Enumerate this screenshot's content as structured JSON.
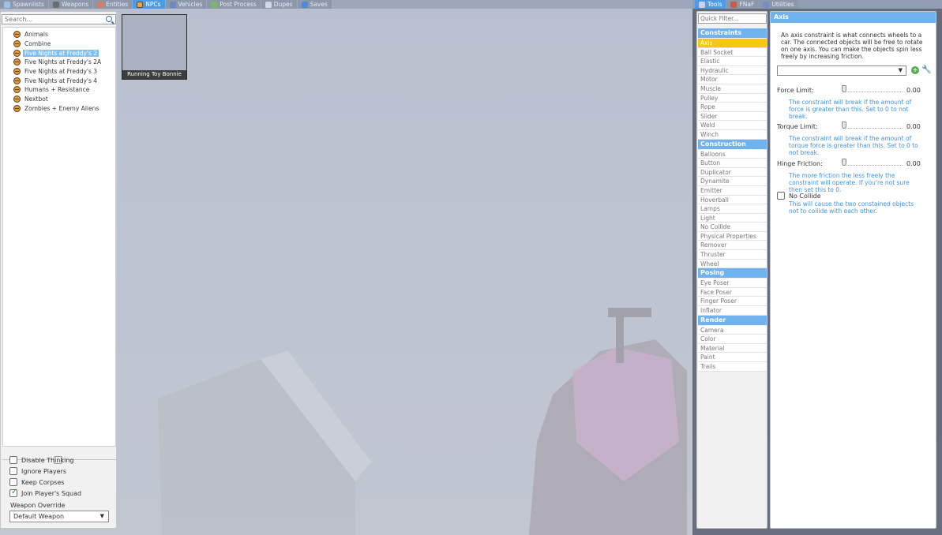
{
  "spawnmenu": {
    "tabs": [
      {
        "label": "Spawnlists",
        "icon": "grid-icon"
      },
      {
        "label": "Weapons",
        "icon": "gun-icon"
      },
      {
        "label": "Entities",
        "icon": "entity-icon"
      },
      {
        "label": "NPCs",
        "icon": "npc-face-icon"
      },
      {
        "label": "Vehicles",
        "icon": "car-icon"
      },
      {
        "label": "Post Process",
        "icon": "film-icon"
      },
      {
        "label": "Dupes",
        "icon": "dupe-icon"
      },
      {
        "label": "Saves",
        "icon": "save-icon"
      }
    ],
    "search_placeholder": "Search...",
    "npc_categories": [
      "Animals",
      "Combine",
      "Five Nights at Freddy's 2",
      "Five Nights at Freddy's 2A",
      "Five Nights at Freddy's 3",
      "Five Nights at Freddy's 4",
      "Humans + Resistance",
      "Nextbot",
      "Zombies + Enemy Aliens"
    ],
    "selected_category": "Five Nights at Freddy's 2",
    "options": {
      "disable_thinking": {
        "label": "Disable Thinking",
        "checked": false
      },
      "ignore_players": {
        "label": "Ignore Players",
        "checked": false
      },
      "keep_corpses": {
        "label": "Keep Corpses",
        "checked": false
      },
      "join_squad": {
        "label": "Join Player's Squad",
        "checked": true
      }
    },
    "weapon_override_label": "Weapon Override",
    "weapon_override_value": "Default Weapon",
    "spawn_icons": [
      {
        "caption": "Running Toy Bonnie"
      }
    ]
  },
  "context": {
    "tabs": [
      {
        "label": "Tools",
        "icon": "wrench-icon"
      },
      {
        "label": "FNaF",
        "icon": "fnaf-icon"
      },
      {
        "label": "Utilities",
        "icon": "utilities-icon"
      }
    ],
    "quick_filter_placeholder": "Quick Filter...",
    "categories": [
      {
        "name": "Constraints",
        "tools": [
          "Axis",
          "Ball Socket",
          "Elastic",
          "Hydraulic",
          "Motor",
          "Muscle",
          "Pulley",
          "Rope",
          "Slider",
          "Weld",
          "Winch"
        ]
      },
      {
        "name": "Construction",
        "tools": [
          "Balloons",
          "Button",
          "Duplicator",
          "Dynamite",
          "Emitter",
          "Hoverball",
          "Lamps",
          "Light",
          "No Collide",
          "Physical Properties",
          "Remover",
          "Thruster",
          "Wheel"
        ]
      },
      {
        "name": "Posing",
        "tools": [
          "Eye Poser",
          "Face Poser",
          "Finger Poser",
          "Inflator"
        ]
      },
      {
        "name": "Render",
        "tools": [
          "Camera",
          "Color",
          "Material",
          "Paint",
          "Trails"
        ]
      }
    ],
    "selected_tool": "Axis",
    "properties": {
      "title": "Axis",
      "description": "An axis constraint is what connects wheels to a car. The connected objects will be free to rotate on one axis. You can make the objects spin less freely by increasing friction.",
      "preset_value": "",
      "sliders": [
        {
          "label": "Force Limit:",
          "value": "0.00",
          "level": 0,
          "help": "The constraint will break if the amount of force is greater than this. Set to 0 to not break."
        },
        {
          "label": "Torque Limit:",
          "value": "0.00",
          "level": 0,
          "help": "The constraint will break if the amount of torque force is greater than this. Set to 0 to not break."
        },
        {
          "label": "Hinge Friction:",
          "value": "0.00",
          "level": 0,
          "help": "The more friction the less freely the constraint will operate. If you're not sure then set this to 0."
        }
      ],
      "nocollide": {
        "label": "No Collide",
        "checked": false,
        "help": "This will cause the two constained objects not to collide with each other."
      }
    }
  }
}
